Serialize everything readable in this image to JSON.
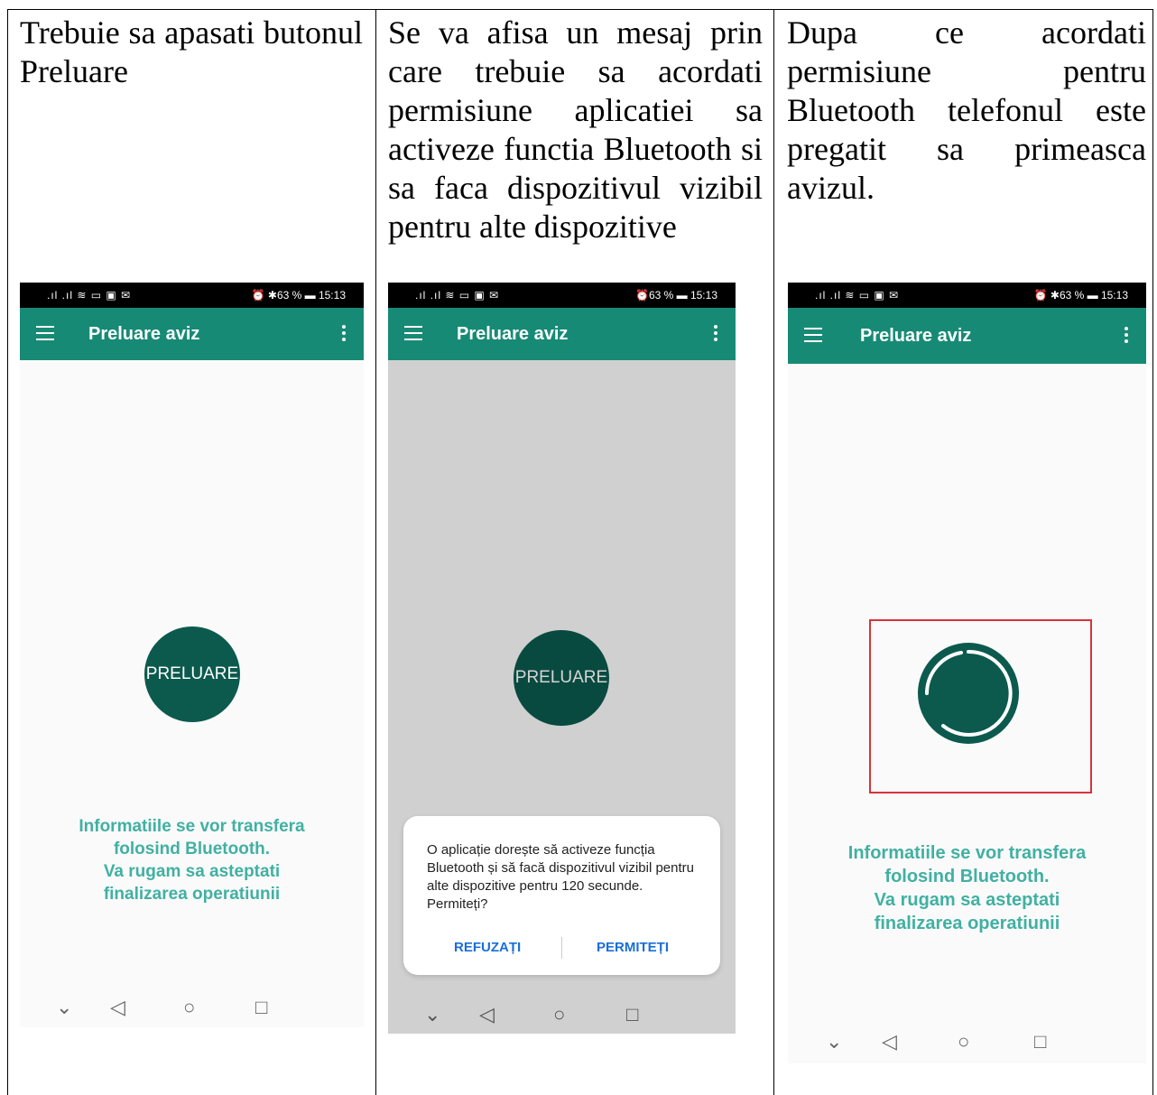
{
  "instructions": {
    "col1": "Trebuie sa apasati butonul Preluare",
    "col2": "Se va afisa un mesaj prin care trebuie sa acordati permisiune aplicatiei sa activeze functia Bluetooth si sa faca dispozitivul vizibil pentru alte dispozitive",
    "col3": "Dupa ce acordati permisiune pentru Bluetooth telefonul este pregatit sa primeasca avizul."
  },
  "phones": [
    {
      "status_left": ".ıl .ıl ≋ ▭ ▣ ✉",
      "status_right": "⏰ ✱63 % ▬ 15:13",
      "title": "Preluare aviz",
      "button_label": "PRELUARE",
      "info": [
        "Informatiile se vor transfera",
        "folosind Bluetooth.",
        "Va rugam sa asteptati",
        "finalizarea operatiunii"
      ]
    },
    {
      "status_left": ".ıl .ıl ≋ ▭ ▣ ✉",
      "status_right": "⏰63 % ▬ 15:13",
      "title": "Preluare aviz",
      "button_label": "PRELUARE",
      "dialog": {
        "message": "O aplicație dorește să activeze funcția Bluetooth și să facă dispozitivul vizibil pentru alte dispozitive pentru 120 secunde. Permiteți?",
        "deny": "REFUZAȚI",
        "allow": "PERMITEȚI"
      }
    },
    {
      "status_left": ".ıl .ıl ≋ ▭ ▣ ✉",
      "status_right": "⏰ ✱63 % ▬ 15:13",
      "title": "Preluare aviz",
      "info": [
        "Informatiile se vor transfera",
        "folosind Bluetooth.",
        "Va rugam sa asteptati",
        "finalizarea operatiunii"
      ]
    }
  ],
  "navbar_icons": [
    "chevron-down-icon",
    "back-icon",
    "home-icon",
    "recents-icon"
  ],
  "colors": {
    "appbar": "#178a76",
    "button": "#0c5a4e",
    "info_text": "#41b0a2",
    "dialog_button": "#1a6ed8",
    "highlight": "#d8333a"
  }
}
